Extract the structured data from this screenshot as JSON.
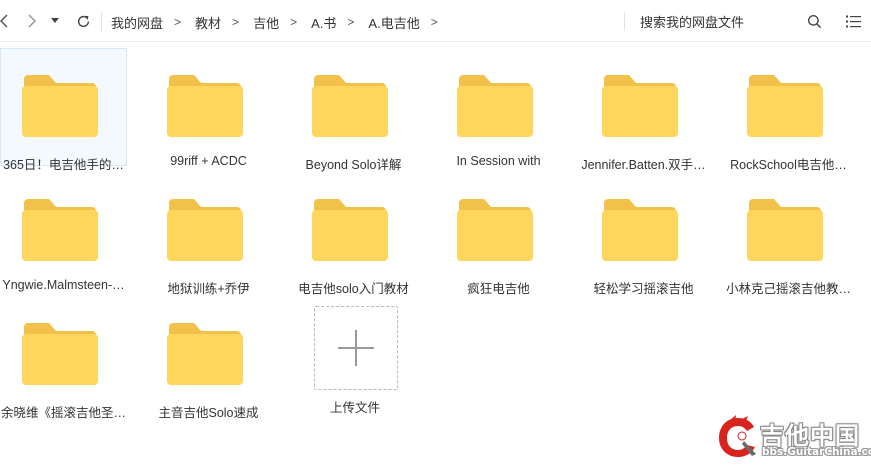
{
  "nav": {
    "back": "chevron-left-icon",
    "forward": "chevron-right-icon",
    "dropdown": "caret-down-icon",
    "refresh": "refresh-icon"
  },
  "breadcrumbs": [
    "我的网盘",
    "教材",
    "吉他",
    "A.书",
    "A.电吉他"
  ],
  "search": {
    "placeholder": "搜索我的网盘文件"
  },
  "colors": {
    "folder_body": "#ffd65c",
    "folder_tab": "#f2c14a",
    "selection": "#f3f9fe"
  },
  "folders": [
    "365日！电吉他手的…",
    "99riff + ACDC",
    "Beyond Solo详解",
    "In Session with",
    "Jennifer.Batten.双手…",
    "RockSchool电吉他…",
    "Yngwie.Malmsteen-…",
    "地狱训练+乔伊",
    "电吉他solo入门教材",
    "疯狂电吉他",
    "轻松学习摇滚吉他",
    "小林克己摇滚吉他教…",
    "余晓维《摇滚吉他圣…",
    "主音吉他Solo速成"
  ],
  "upload": {
    "label": "上传文件"
  },
  "watermark": {
    "title": "吉他中国",
    "subtitle": "bbs.GuitarChina.com"
  }
}
